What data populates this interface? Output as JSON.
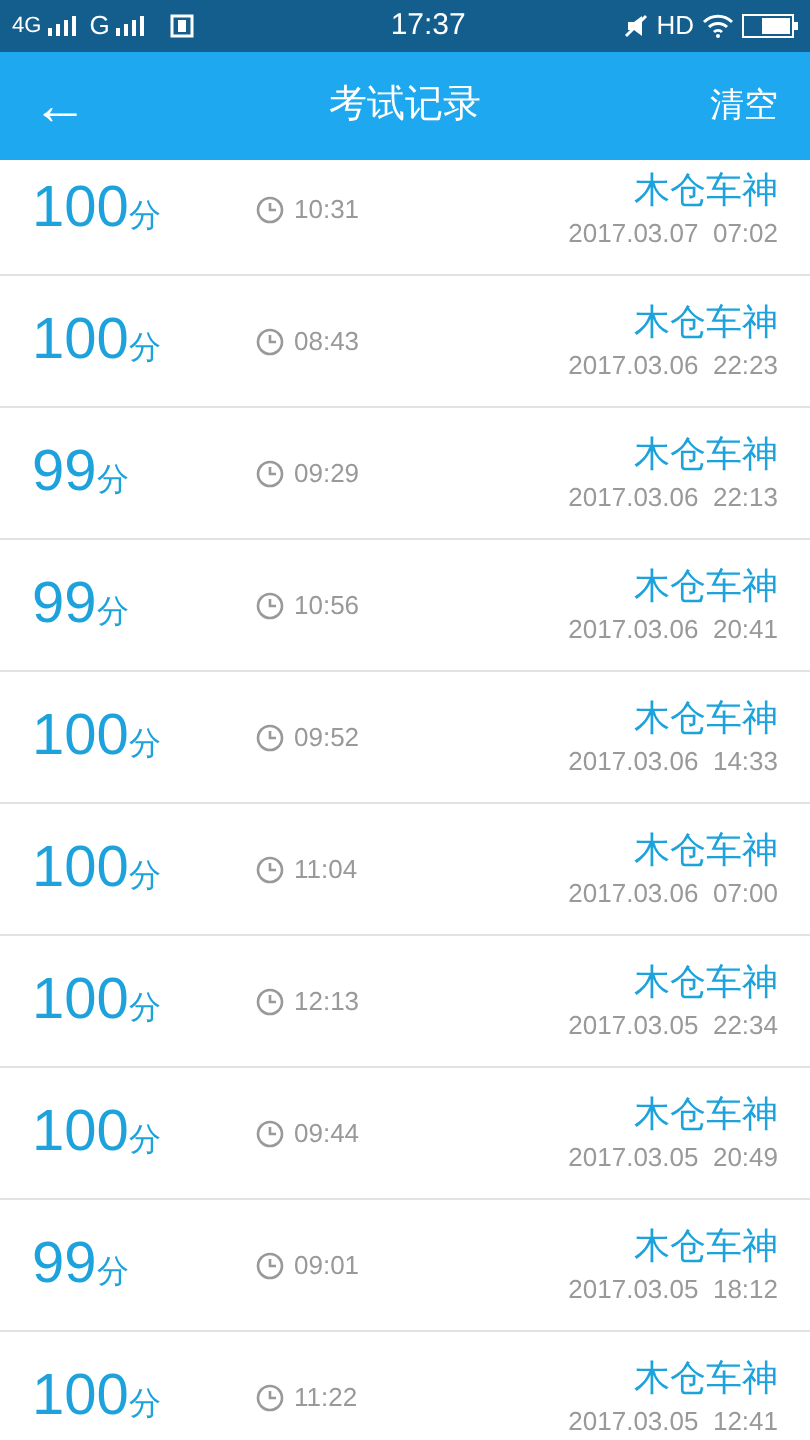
{
  "status_bar": {
    "network_1": "4G",
    "network_2": "G",
    "time": "17:37",
    "hd": "HD"
  },
  "header": {
    "back": "←",
    "title": "考试记录",
    "action": "清空"
  },
  "records": [
    {
      "score": "100",
      "unit": "分",
      "duration": "10:31",
      "name": "木仓车神",
      "date": "2017.03.07  07:02"
    },
    {
      "score": "100",
      "unit": "分",
      "duration": "08:43",
      "name": "木仓车神",
      "date": "2017.03.06  22:23"
    },
    {
      "score": "99",
      "unit": "分",
      "duration": "09:29",
      "name": "木仓车神",
      "date": "2017.03.06  22:13"
    },
    {
      "score": "99",
      "unit": "分",
      "duration": "10:56",
      "name": "木仓车神",
      "date": "2017.03.06  20:41"
    },
    {
      "score": "100",
      "unit": "分",
      "duration": "09:52",
      "name": "木仓车神",
      "date": "2017.03.06  14:33"
    },
    {
      "score": "100",
      "unit": "分",
      "duration": "11:04",
      "name": "木仓车神",
      "date": "2017.03.06  07:00"
    },
    {
      "score": "100",
      "unit": "分",
      "duration": "12:13",
      "name": "木仓车神",
      "date": "2017.03.05  22:34"
    },
    {
      "score": "100",
      "unit": "分",
      "duration": "09:44",
      "name": "木仓车神",
      "date": "2017.03.05  20:49"
    },
    {
      "score": "99",
      "unit": "分",
      "duration": "09:01",
      "name": "木仓车神",
      "date": "2017.03.05  18:12"
    },
    {
      "score": "100",
      "unit": "分",
      "duration": "11:22",
      "name": "木仓车神",
      "date": "2017.03.05  12:41"
    }
  ]
}
